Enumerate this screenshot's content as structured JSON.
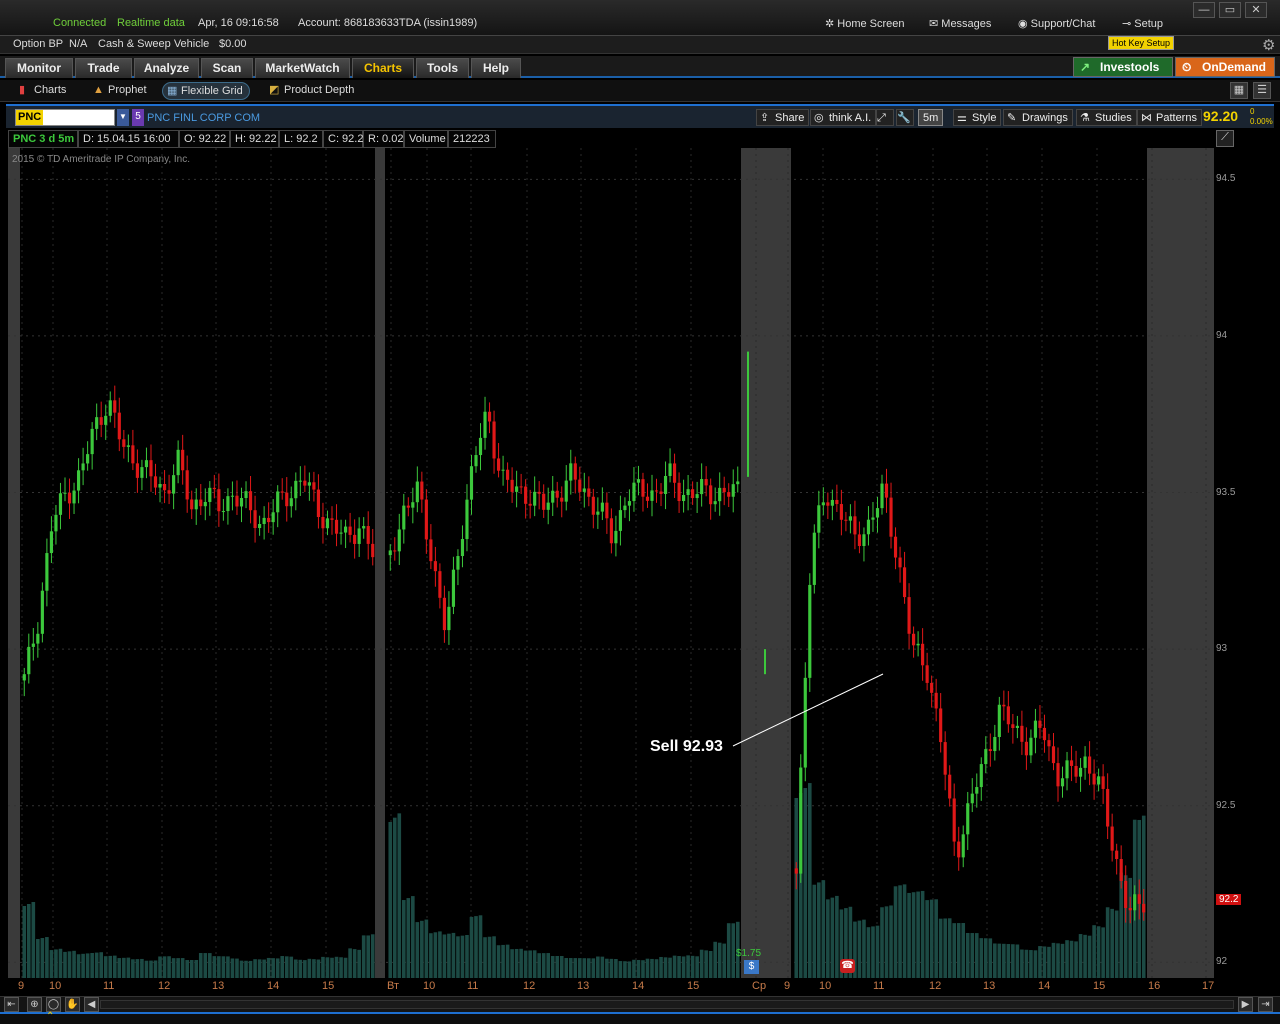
{
  "status": {
    "connected": "Connected",
    "realtime": "Realtime data",
    "datetime": "Apr, 16  09:16:58",
    "account": "Account: 868183633TDA (issin1989)",
    "home_screen": "Home Screen",
    "messages": "Messages",
    "support": "Support/Chat",
    "setup": "Setup"
  },
  "account_bar": {
    "option_bp_label": "Option BP",
    "option_bp_value": "N/A",
    "cash_label": "Cash & Sweep Vehicle",
    "cash_value": "$0.00",
    "hotkey": "Hot Key Setup"
  },
  "tabs": [
    "Monitor",
    "Trade",
    "Analyze",
    "Scan",
    "MarketWatch",
    "Charts",
    "Tools",
    "Help"
  ],
  "active_tab": "Charts",
  "investools": "Investools",
  "ondemand": "OnDemand",
  "subtabs": [
    "Charts",
    "Prophet",
    "Flexible Grid",
    "Product Depth"
  ],
  "symbol": {
    "ticker": "PNC",
    "link_num": "5",
    "company": "PNC FINL CORP COM",
    "price": "92.20",
    "change": "0",
    "change_pct": "0.00%"
  },
  "chart_toolbar": {
    "share": "Share",
    "think_ai": "think A.I.",
    "aggregation": "5m",
    "style": "Style",
    "drawings": "Drawings",
    "studies": "Studies",
    "patterns": "Patterns"
  },
  "info": {
    "title": "PNC 3 d 5m",
    "date": "D: 15.04.15 16:00",
    "open": "O: 92.22",
    "high": "H: 92.22",
    "low": "L: 92.2",
    "close": "C: 92.2",
    "range": "R: 0.02",
    "volume_label": "Volume",
    "volume_value": "212223"
  },
  "copyright": "2015 © TD Ameritrade IP Company, Inc.",
  "annotation": "Sell 92.93",
  "dividend_label": "$1.75",
  "last_price_tag": "92.2",
  "price_ticks": [
    "94.5",
    "94",
    "93.5",
    "93",
    "92.5",
    "92"
  ],
  "time_ticks": [
    "9",
    "10",
    "11",
    "12",
    "13",
    "14",
    "15",
    "Вт",
    "10",
    "11",
    "12",
    "13",
    "14",
    "15",
    "Ср",
    "9",
    "10",
    "11",
    "12",
    "13",
    "14",
    "15",
    "16",
    "17"
  ],
  "colors": {
    "up": "#3cc83c",
    "down": "#e01818",
    "volume": "#1c4a44",
    "accent": "#1e6fd0",
    "premarket": "#3a3a3a"
  },
  "chart_data": {
    "type": "candlestick",
    "title": "PNC 3 d 5m",
    "ylim": [
      91.95,
      94.6
    ],
    "price_path": [
      [
        92.9,
        93.1,
        93.4,
        93.5,
        93.55,
        93.7,
        93.8,
        93.65,
        93.6,
        93.55,
        93.5,
        93.6,
        93.45,
        93.5,
        93.45,
        93.5,
        93.45,
        93.4,
        93.45,
        93.5,
        93.55,
        93.45,
        93.4,
        93.35,
        93.4,
        93.3
      ],
      [
        93.3,
        93.45,
        93.5,
        93.3,
        93.05,
        93.35,
        93.6,
        93.75,
        93.55,
        93.5,
        93.5,
        93.45,
        93.5,
        93.55,
        93.5,
        93.45,
        93.35,
        93.5,
        93.5,
        93.5,
        93.55,
        93.5,
        93.5,
        93.5,
        93.5,
        93.5
      ],
      [
        92.3,
        93.3,
        93.5,
        93.45,
        93.35,
        93.4,
        93.5,
        93.3,
        93.0,
        92.95,
        92.7,
        92.35,
        92.5,
        92.65,
        92.8,
        92.75,
        92.7,
        92.75,
        92.6,
        92.6,
        92.65,
        92.55,
        92.35,
        92.15,
        92.2
      ]
    ],
    "volume_profile": [
      [
        120,
        60,
        40,
        35,
        30,
        30,
        25,
        22,
        20,
        18,
        22,
        20,
        18,
        25,
        22,
        20,
        18,
        20,
        22,
        25,
        22,
        24,
        28,
        30,
        45,
        70
      ],
      [
        260,
        120,
        80,
        60,
        55,
        50,
        70,
        45,
        35,
        30,
        28,
        25,
        22,
        20,
        20,
        22,
        20,
        18,
        20,
        22,
        25,
        28,
        30,
        40,
        55,
        90
      ],
      [
        300,
        140,
        110,
        90,
        70,
        60,
        80,
        100,
        90,
        80,
        60,
        55,
        45,
        40,
        35,
        35,
        30,
        35,
        40,
        45,
        55,
        70,
        100,
        160,
        260
      ]
    ]
  }
}
